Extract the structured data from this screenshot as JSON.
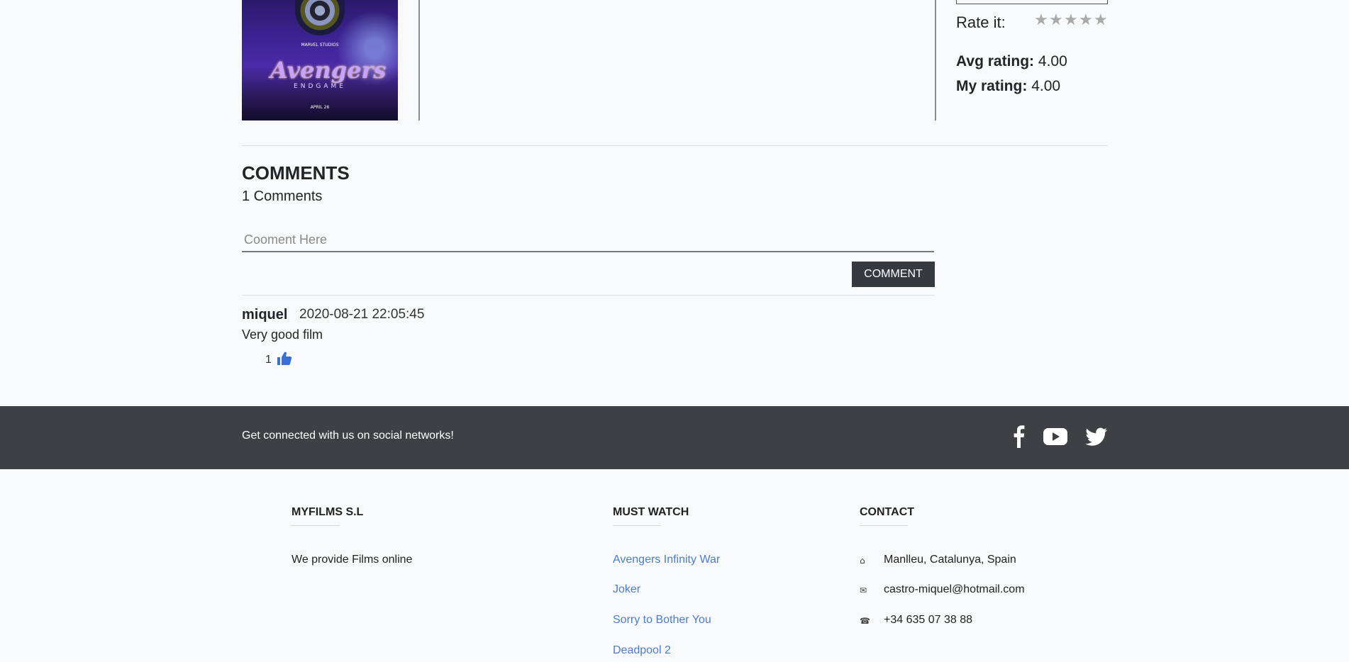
{
  "movie": {
    "poster": {
      "title_art": "Avengers",
      "subtitle_art": "ENDGAME",
      "studio": "MARVEL STUDIOS",
      "date": "APRIL 26"
    },
    "rate_label": "Rate it:",
    "stars": 5,
    "avg_label": "Avg rating:",
    "avg_value": "4.00",
    "my_label": "My rating:",
    "my_value": "4.00"
  },
  "comments": {
    "title": "COMMENTS",
    "count_text": "1 Comments",
    "input_placeholder": "Cooment Here",
    "button_label": "COMMENT",
    "items": [
      {
        "user": "miquel",
        "date": "2020-08-21 22:05:45",
        "text": "Very good film",
        "likes": "1"
      }
    ]
  },
  "social": {
    "text": "Get connected with us on social networks!",
    "icons": [
      "facebook-icon",
      "youtube-icon",
      "twitter-icon"
    ]
  },
  "footer": {
    "company": {
      "title": "MYFILMS S.L",
      "text": "We provide Films online"
    },
    "must_watch": {
      "title": "MUST WATCH",
      "links": [
        "Avengers Infinity War",
        "Joker",
        "Sorry to Bother You",
        "Deadpool 2"
      ]
    },
    "contact": {
      "title": "CONTACT",
      "items": [
        {
          "icon": "home-icon",
          "text": "Manlleu, Catalunya, Spain"
        },
        {
          "icon": "envelope-icon",
          "text": "castro-miquel@hotmail.com"
        },
        {
          "icon": "phone-icon",
          "text": "+34 635 07 38 88"
        }
      ]
    }
  },
  "colors": {
    "dark_bar": "#3e4043",
    "button": "#343a40",
    "link": "#4d7cc9",
    "star": "#a9a9a9",
    "thumb": "#3a6fd8"
  }
}
